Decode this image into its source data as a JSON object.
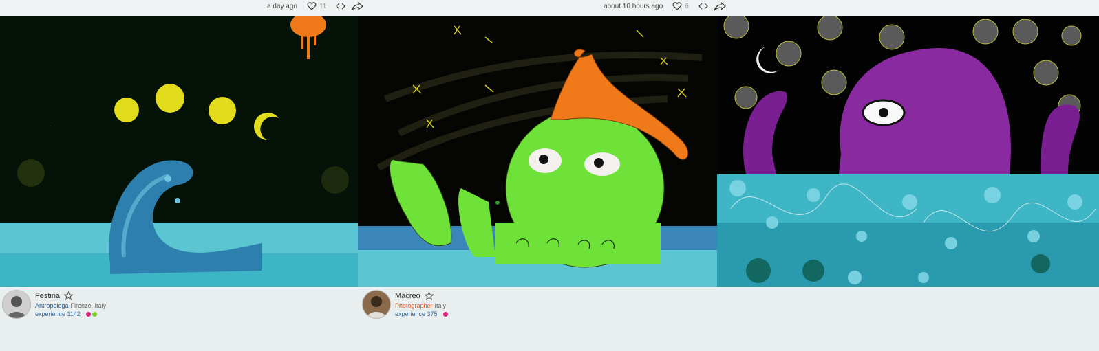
{
  "posts": [
    {
      "time": "a day ago",
      "likes": "11",
      "author": {
        "name": "Festina",
        "role": "Antropologa",
        "location": "Firenze, Italy",
        "experience": "experience 1142",
        "role_color": "#2b5a8a",
        "badges": [
          "#e0207a",
          "#78c832"
        ]
      }
    },
    {
      "time": "about 10 hours ago",
      "likes": "6",
      "author": {
        "name": "Macreo",
        "role": "Photographer",
        "location": "Italy",
        "experience": "experience 375",
        "role_color": "#e05a2a",
        "badges": [
          "#e0207a"
        ]
      }
    }
  ],
  "icons": {
    "like": "heart-icon",
    "embed": "code-icon",
    "share": "share-icon",
    "favorite": "star-icon"
  }
}
